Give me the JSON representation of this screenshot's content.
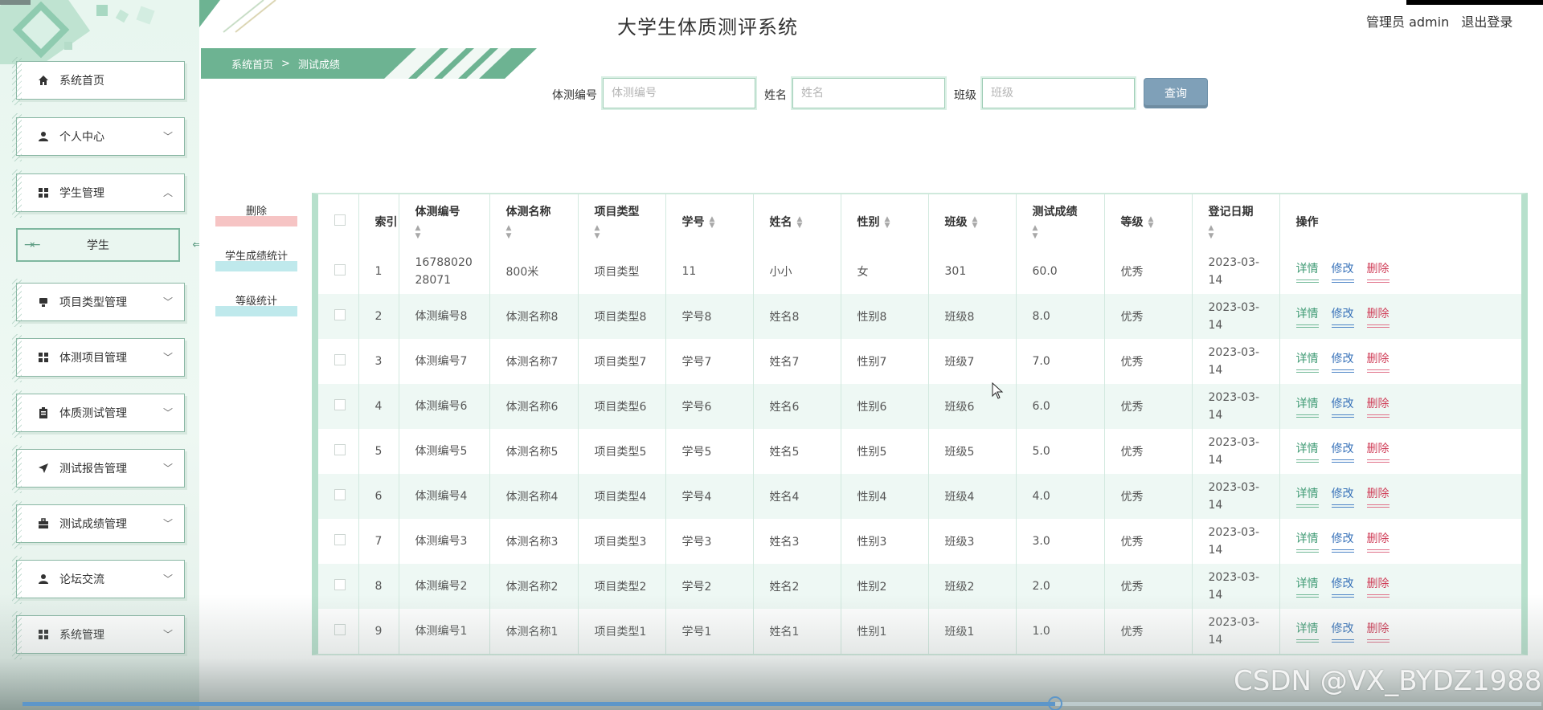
{
  "app": {
    "title": "大学生体质测评系统"
  },
  "user": {
    "role_name": "管理员 admin",
    "logout_label": "退出登录"
  },
  "breadcrumb": {
    "home": "系统首页",
    "separator": ">",
    "current": "测试成绩"
  },
  "sidebar": {
    "items": [
      {
        "label": "系统首页",
        "icon": "home-icon",
        "arrow": ""
      },
      {
        "label": "个人中心",
        "icon": "user-icon",
        "arrow": "﹀"
      },
      {
        "label": "学生管理",
        "icon": "grid-icon",
        "arrow": "︿"
      },
      {
        "label": "项目类型管理",
        "icon": "monitor-icon",
        "arrow": "﹀"
      },
      {
        "label": "体测项目管理",
        "icon": "grid-icon",
        "arrow": "﹀"
      },
      {
        "label": "体质测试管理",
        "icon": "clipboard-icon",
        "arrow": "﹀"
      },
      {
        "label": "测试报告管理",
        "icon": "send-icon",
        "arrow": "﹀"
      },
      {
        "label": "测试成绩管理",
        "icon": "briefcase-icon",
        "arrow": "﹀"
      },
      {
        "label": "论坛交流",
        "icon": "user-icon",
        "arrow": "﹀"
      },
      {
        "label": "系统管理",
        "icon": "grid-icon",
        "arrow": "﹀"
      }
    ],
    "submenu": {
      "label": "学生"
    }
  },
  "search": {
    "fields": [
      {
        "label": "体测编号",
        "placeholder": "体测编号",
        "value": ""
      },
      {
        "label": "姓名",
        "placeholder": "姓名",
        "value": ""
      },
      {
        "label": "班级",
        "placeholder": "班级",
        "value": ""
      }
    ],
    "button_label": "查询"
  },
  "actions": {
    "delete": "删除",
    "score_stats": "学生成绩统计",
    "grade_stats": "等级统计"
  },
  "table": {
    "headers": {
      "index": "索引",
      "test_no": "体测编号",
      "test_name": "体测名称",
      "type": "项目类型",
      "student_no": "学号",
      "name": "姓名",
      "gender": "性别",
      "class": "班级",
      "score": "测试成绩",
      "grade": "等级",
      "date": "登记日期",
      "ops": "操作"
    },
    "ops": {
      "detail": "详情",
      "edit": "修改",
      "delete": "删除"
    },
    "rows": [
      {
        "index": "1",
        "test_no": "1678802028071",
        "test_name": "800米",
        "type": "项目类型",
        "student_no": "11",
        "name": "小小",
        "gender": "女",
        "class": "301",
        "score": "60.0",
        "grade": "优秀",
        "date": "2023-03-14"
      },
      {
        "index": "2",
        "test_no": "体测编号8",
        "test_name": "体测名称8",
        "type": "项目类型8",
        "student_no": "学号8",
        "name": "姓名8",
        "gender": "性别8",
        "class": "班级8",
        "score": "8.0",
        "grade": "优秀",
        "date": "2023-03-14"
      },
      {
        "index": "3",
        "test_no": "体测编号7",
        "test_name": "体测名称7",
        "type": "项目类型7",
        "student_no": "学号7",
        "name": "姓名7",
        "gender": "性别7",
        "class": "班级7",
        "score": "7.0",
        "grade": "优秀",
        "date": "2023-03-14"
      },
      {
        "index": "4",
        "test_no": "体测编号6",
        "test_name": "体测名称6",
        "type": "项目类型6",
        "student_no": "学号6",
        "name": "姓名6",
        "gender": "性别6",
        "class": "班级6",
        "score": "6.0",
        "grade": "优秀",
        "date": "2023-03-14"
      },
      {
        "index": "5",
        "test_no": "体测编号5",
        "test_name": "体测名称5",
        "type": "项目类型5",
        "student_no": "学号5",
        "name": "姓名5",
        "gender": "性别5",
        "class": "班级5",
        "score": "5.0",
        "grade": "优秀",
        "date": "2023-03-14"
      },
      {
        "index": "6",
        "test_no": "体测编号4",
        "test_name": "体测名称4",
        "type": "项目类型4",
        "student_no": "学号4",
        "name": "姓名4",
        "gender": "性别4",
        "class": "班级4",
        "score": "4.0",
        "grade": "优秀",
        "date": "2023-03-14"
      },
      {
        "index": "7",
        "test_no": "体测编号3",
        "test_name": "体测名称3",
        "type": "项目类型3",
        "student_no": "学号3",
        "name": "姓名3",
        "gender": "性别3",
        "class": "班级3",
        "score": "3.0",
        "grade": "优秀",
        "date": "2023-03-14"
      },
      {
        "index": "8",
        "test_no": "体测编号2",
        "test_name": "体测名称2",
        "type": "项目类型2",
        "student_no": "学号2",
        "name": "姓名2",
        "gender": "性别2",
        "class": "班级2",
        "score": "2.0",
        "grade": "优秀",
        "date": "2023-03-14"
      },
      {
        "index": "9",
        "test_no": "体测编号1",
        "test_name": "体测名称1",
        "type": "项目类型1",
        "student_no": "学号1",
        "name": "姓名1",
        "gender": "性别1",
        "class": "班级1",
        "score": "1.0",
        "grade": "优秀",
        "date": "2023-03-14"
      }
    ]
  },
  "video": {
    "progress_percent": 68
  },
  "watermark": "CSDN @VX_BYDZ1988",
  "colors": {
    "accent_green": "#6db392",
    "search_button": "#7fa0b8",
    "delete_red": "#d0405a",
    "edit_blue": "#3570b8"
  }
}
